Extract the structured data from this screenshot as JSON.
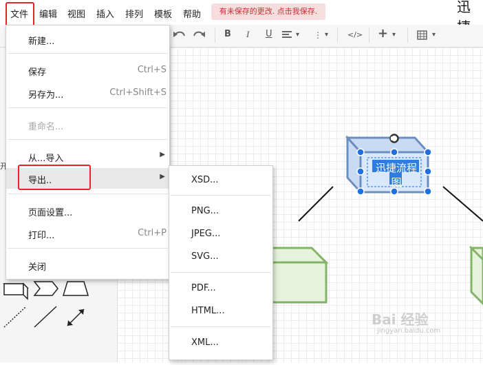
{
  "menubar": {
    "items": [
      "文件",
      "编辑",
      "视图",
      "插入",
      "排列",
      "模板",
      "帮助"
    ],
    "unsaved_notice": "有未保存的更改. 点击我保存.",
    "title_fragment": "迅捷"
  },
  "toolbar": {
    "bold": "B",
    "italic": "I",
    "underline": "U",
    "code": "</>",
    "add": "+",
    "caret": "▾"
  },
  "file_menu": {
    "items": [
      {
        "label": "新建...",
        "shortcut": ""
      },
      {
        "label": "保存",
        "shortcut": "Ctrl+S"
      },
      {
        "label": "另存为...",
        "shortcut": "Ctrl+Shift+S"
      },
      {
        "label": "重命名...",
        "shortcut": "",
        "disabled": true
      },
      {
        "label": "从...导入",
        "shortcut": ""
      },
      {
        "label": "导出..",
        "shortcut": ""
      },
      {
        "label": "页面设置...",
        "shortcut": ""
      },
      {
        "label": "打印...",
        "shortcut": "Ctrl+P"
      },
      {
        "label": "关闭",
        "shortcut": ""
      }
    ],
    "submenu_arrow": "▶"
  },
  "export_menu": {
    "items": [
      "XSD...",
      "PNG...",
      "JPEG...",
      "SVG...",
      "PDF...",
      "HTML...",
      "XML..."
    ]
  },
  "canvas": {
    "selected_shape_label": "迅捷流程图"
  },
  "watermark": {
    "text": "Bai 经验",
    "sub": "jingyan.baidu.com"
  },
  "colors": {
    "highlight_red": "#e3242b",
    "shape_blue_stroke": "#6c8ebf",
    "shape_blue_fill": "#dae8fc",
    "shape_green_stroke": "#82b366",
    "shape_green_fill": "#e6f2dc",
    "selection_handle": "#1e6fe0"
  }
}
